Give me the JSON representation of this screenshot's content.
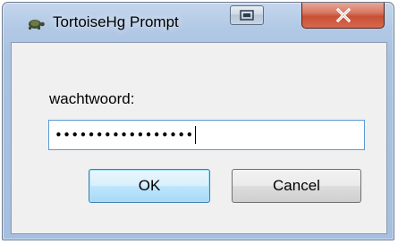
{
  "window": {
    "title": "TortoiseHg Prompt",
    "close_label": "X"
  },
  "prompt": {
    "label": "wachtwoord:",
    "masked_value": "•••••••••••••••••"
  },
  "buttons": {
    "ok_label": "OK",
    "cancel_label": "Cancel"
  },
  "icons": {
    "app": "tortoise-icon",
    "restore": "restore-window-icon",
    "close": "close-icon"
  },
  "colors": {
    "close_button": "#c74f35",
    "focus_border": "#5b9bd5",
    "default_button_border": "#3c7fb1"
  }
}
